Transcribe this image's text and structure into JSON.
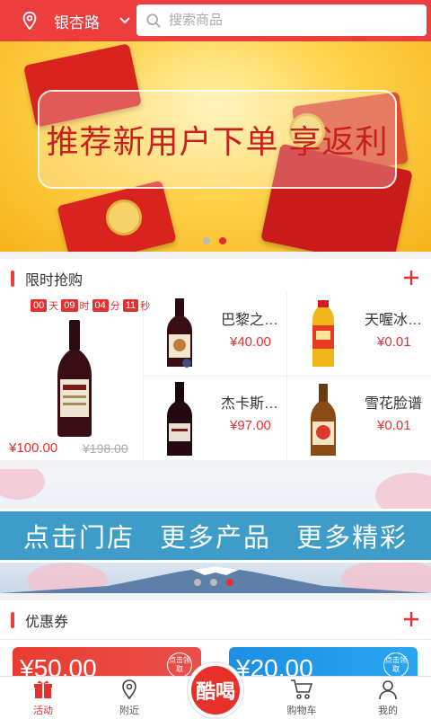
{
  "header": {
    "location": "银杏路",
    "search_placeholder": "搜索商品"
  },
  "banner": {
    "text": "推荐新用户下单 享返利",
    "active_index": 1,
    "dot_count": 2
  },
  "flash_sale": {
    "title": "限时抢购",
    "countdown": {
      "days": "00",
      "day_unit": "天",
      "hours": "09",
      "hour_unit": "时",
      "minutes": "04",
      "minute_unit": "分",
      "seconds": "11",
      "second_unit": "秒"
    },
    "main_product": {
      "price": "¥100.00",
      "old_price": "¥198.00"
    },
    "products": [
      {
        "name": "巴黎之…",
        "price": "¥40.00"
      },
      {
        "name": "天喔冰…",
        "price": "¥0.01"
      },
      {
        "name": "杰卡斯…",
        "price": "¥97.00"
      },
      {
        "name": "雪花脸谱",
        "price": "¥0.01"
      }
    ]
  },
  "store_banner": {
    "text": "点击门店 更多产品 更多精彩",
    "active_index": 2,
    "dot_count": 3
  },
  "coupons": {
    "title": "优惠券",
    "items": [
      {
        "value": "¥50.00",
        "badge": "点击领取",
        "color": "#ea3b2f"
      },
      {
        "value": "¥20.00",
        "badge": "点击领取",
        "color": "#1b8fe4"
      }
    ]
  },
  "bottom_nav": {
    "items": [
      {
        "label": "活动",
        "icon": "gift-icon"
      },
      {
        "label": "附近",
        "icon": "location-pin-icon"
      },
      {
        "label": "",
        "icon": "center-logo"
      },
      {
        "label": "购物车",
        "icon": "cart-icon"
      },
      {
        "label": "我的",
        "icon": "user-icon"
      }
    ],
    "center_logo": "酷喝"
  },
  "colors": {
    "brand": "#ee3d3d",
    "price": "#e53030"
  }
}
